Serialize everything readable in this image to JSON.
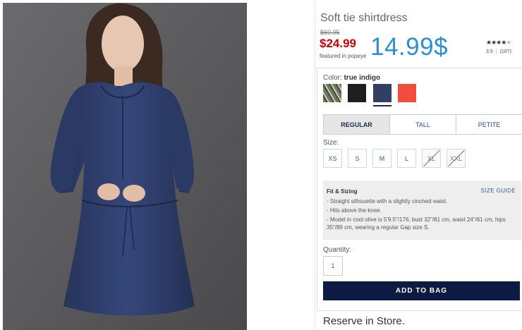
{
  "product": {
    "title": "Soft tie shirtdress",
    "original_price": "$60.05",
    "sale_price": "$24.99",
    "featured_note": "featured in popeye",
    "big_price": "14.99$",
    "rating": {
      "stars": 3.5,
      "score": "3.5",
      "reviews": "(107)"
    },
    "image_alt": "Model wearing a navy long-sleeve shirtdress"
  },
  "color": {
    "label": "Color:",
    "selected": "true indigo",
    "swatches": [
      {
        "name": "cool olive stripe",
        "hex": "#5f6b52"
      },
      {
        "name": "black",
        "hex": "#1e1e1e"
      },
      {
        "name": "true indigo",
        "hex": "#323f64",
        "selected": true
      },
      {
        "name": "coral",
        "hex": "#f24c3d"
      }
    ]
  },
  "fit_tabs": [
    {
      "label": "REGULAR",
      "active": true
    },
    {
      "label": "TALL",
      "active": false
    },
    {
      "label": "PETITE",
      "active": false
    }
  ],
  "size": {
    "label": "Size:",
    "options": [
      {
        "label": "XS",
        "available": true
      },
      {
        "label": "S",
        "available": true
      },
      {
        "label": "M",
        "available": true
      },
      {
        "label": "L",
        "available": true
      },
      {
        "label": "XL",
        "available": false
      },
      {
        "label": "XXL",
        "available": false
      }
    ]
  },
  "fit_sizing": {
    "title": "Fit & Sizing",
    "size_guide": "SIZE GUIDE",
    "bullets": [
      "- Straight silhouette with a slightly cinched waist.",
      "- Hits above the knee.",
      "- Model in cool olive is 5'9.5\"/176, bust 32\"/81 cm, waist 24\"/61 cm, hips 35\"/89 cm, wearing a regular Gap size S."
    ]
  },
  "quantity": {
    "label": "Quantity:",
    "value": "1"
  },
  "add_to_bag": "ADD TO BAG",
  "reserve": "Reserve in Store."
}
